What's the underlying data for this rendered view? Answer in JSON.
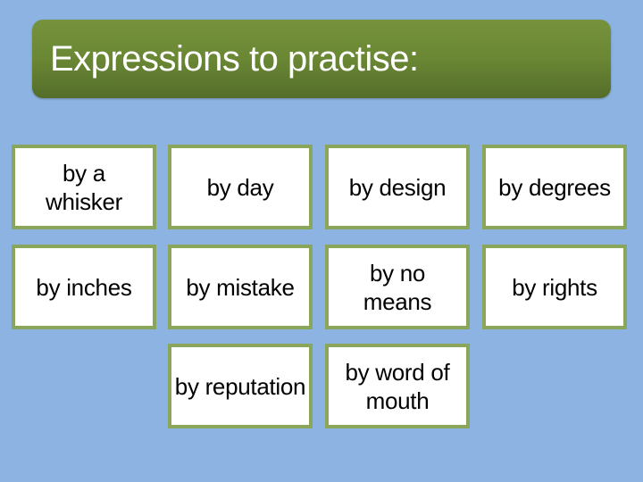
{
  "slide": {
    "title": "Expressions to practise:",
    "colors": {
      "background": "#8db3e2",
      "title_bar": "#6a8734",
      "card_border": "#8aa65a",
      "card_fill": "#ffffff"
    }
  },
  "expressions": {
    "row1": [
      {
        "text": "by a whisker"
      },
      {
        "text": "by day"
      },
      {
        "text": "by design"
      },
      {
        "text": "by degrees"
      }
    ],
    "row2": [
      {
        "text": "by inches"
      },
      {
        "text": "by mistake"
      },
      {
        "text": "by no means"
      },
      {
        "text": "by rights"
      }
    ],
    "row3": [
      {
        "text": "by reputation"
      },
      {
        "text": "by word of mouth"
      }
    ]
  }
}
